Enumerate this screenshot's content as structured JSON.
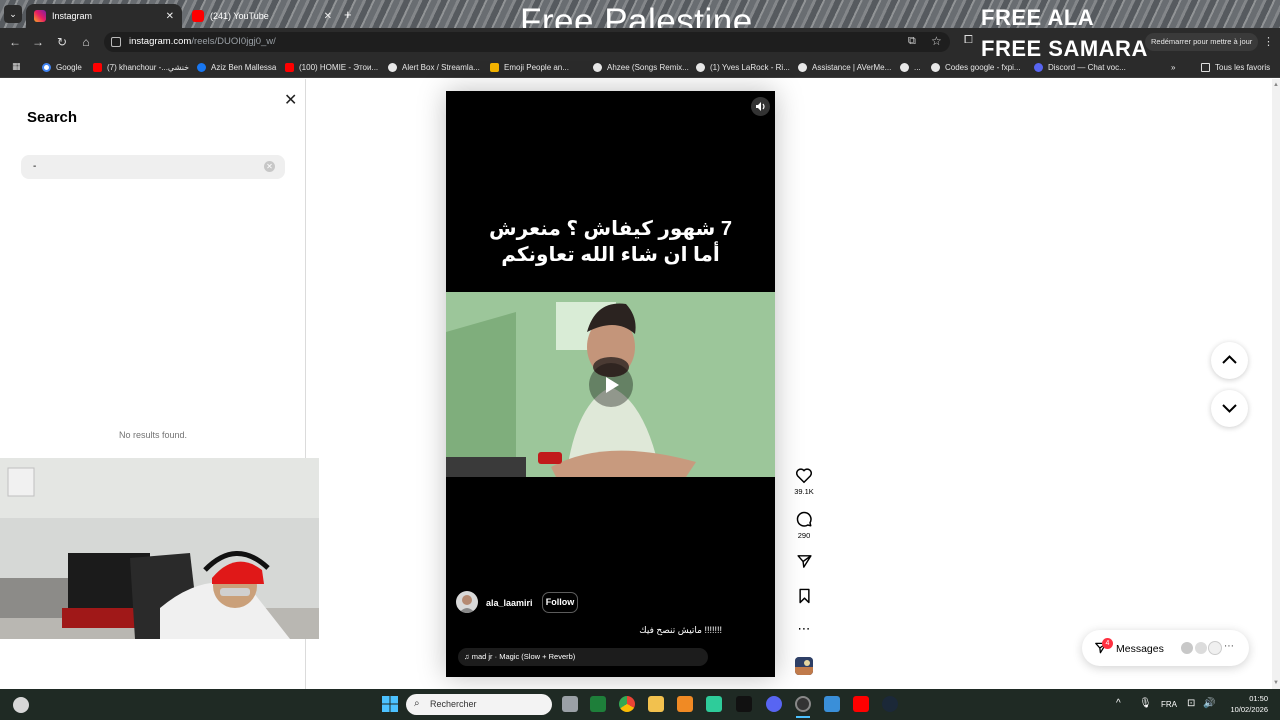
{
  "browser": {
    "tabs": [
      {
        "label": "Instagram",
        "active": true
      },
      {
        "label": "(241) YouTube",
        "active": false
      }
    ],
    "url_host": "instagram.com",
    "url_path": "/reels/DUOI0jgj0_w/",
    "resume_text": "Redémarrer pour mettre à jour",
    "bookmarks": [
      "Google",
      "(7) khanchour -...خنشي",
      "Aziz Ben Mallessa",
      "(100) HOMIE - Этои...",
      "Alert Box / Streamla...",
      "Emoji People an...",
      "Ahzee (Songs Remix...",
      "(1) Yves LaRock - Ri...",
      "Assistance | AVerMe...",
      "Codes google - fxpi...",
      "Discord — Chat voc...",
      "Tous les favoris"
    ]
  },
  "overlay": {
    "title": "Free Palestine",
    "line1": "FREE ALA",
    "line2": "FREE SAMARA"
  },
  "search": {
    "title": "Search",
    "value": "-",
    "no_results": "No results found."
  },
  "reel": {
    "top_caption_line1": "7 شهور كيفاش ؟ منعرش",
    "top_caption_line2": "أما ان شاء الله تعاونكم",
    "username": "ala_laamiri",
    "follow_label": "Follow",
    "caption": "!!!!!!! ماتيش تنصح فيك",
    "audio": "mad jr · Magic (Slow + Reverb)",
    "likes": "39.1K",
    "comments": "290"
  },
  "messages": {
    "label": "Messages",
    "badge": "4"
  },
  "taskbar": {
    "search_label": "Rechercher",
    "lang": "FRA",
    "time": "01:50",
    "date": "10/02/2026"
  },
  "colors": {
    "reel_bg": "#000000",
    "video_green": "#8fbf8c",
    "badge_red": "#ff3040",
    "taskbar": "#1f2a24"
  }
}
